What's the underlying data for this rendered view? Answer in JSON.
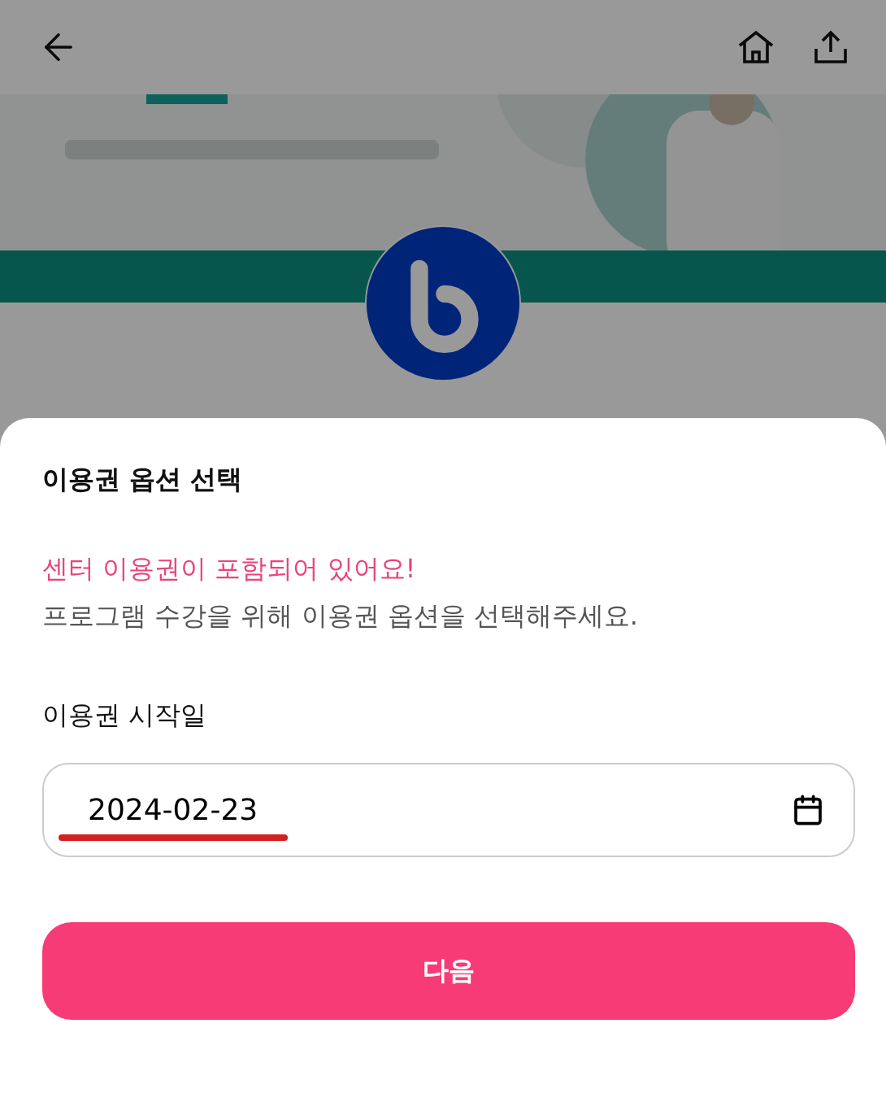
{
  "sheet": {
    "title": "이용권 옵션 선택",
    "notice": "센터 이용권이 포함되어 있어요!",
    "description": "프로그램 수강을 위해 이용권 옵션을 선택해주세요.",
    "start_date": {
      "label": "이용권 시작일",
      "value": "2024-02-23",
      "underlined": true
    },
    "buttons": [
      "다음"
    ]
  }
}
